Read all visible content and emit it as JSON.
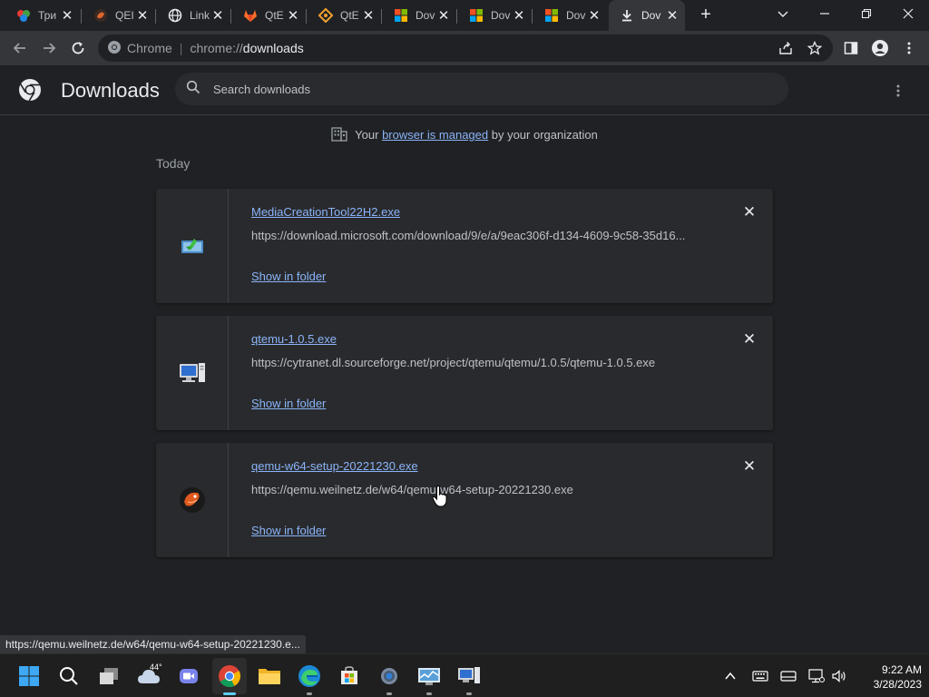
{
  "tabs": [
    {
      "title": "Три",
      "favicon": "puzzle-icon"
    },
    {
      "title": "QEI",
      "favicon": "qemu-icon"
    },
    {
      "title": "Link",
      "favicon": "globe-icon"
    },
    {
      "title": "QtE",
      "favicon": "gitlab-icon"
    },
    {
      "title": "QtE",
      "favicon": "diamond-icon"
    },
    {
      "title": "Dov",
      "favicon": "microsoft-icon"
    },
    {
      "title": "Dov",
      "favicon": "microsoft-icon"
    },
    {
      "title": "Dov",
      "favicon": "microsoft-icon"
    },
    {
      "title": "Dov",
      "favicon": "download-icon",
      "active": true
    }
  ],
  "omnibox": {
    "site_label": "Chrome",
    "url_scheme": "chrome://",
    "url_path": "downloads"
  },
  "page": {
    "title": "Downloads",
    "search_placeholder": "Search downloads",
    "managed_prefix": "Your ",
    "managed_link": "browser is managed",
    "managed_suffix": " by your organization",
    "section_date": "Today"
  },
  "downloads": [
    {
      "name": "MediaCreationTool22H2.exe",
      "url": "https://download.microsoft.com/download/9/e/a/9eac306f-d134-4609-9c58-35d16...",
      "action": "Show in folder",
      "icon": "media-creation-tool-icon"
    },
    {
      "name": "qtemu-1.0.5.exe",
      "url": "https://cytranet.dl.sourceforge.net/project/qtemu/qtemu/1.0.5/qtemu-1.0.5.exe",
      "action": "Show in folder",
      "icon": "computer-icon"
    },
    {
      "name": "qemu-w64-setup-20221230.exe",
      "url": "https://qemu.weilnetz.de/w64/qemu-w64-setup-20221230.exe",
      "action": "Show in folder",
      "icon": "qemu-icon"
    }
  ],
  "status_url": "https://qemu.weilnetz.de/w64/qemu-w64-setup-20221230.e...",
  "taskbar": {
    "weather_temp": "44°",
    "time": "9:22 AM",
    "date": "3/28/2023"
  },
  "colors": {
    "link": "#8ab4f8",
    "background": "#202124",
    "card": "#292a2d",
    "accent": "#60cdff"
  }
}
